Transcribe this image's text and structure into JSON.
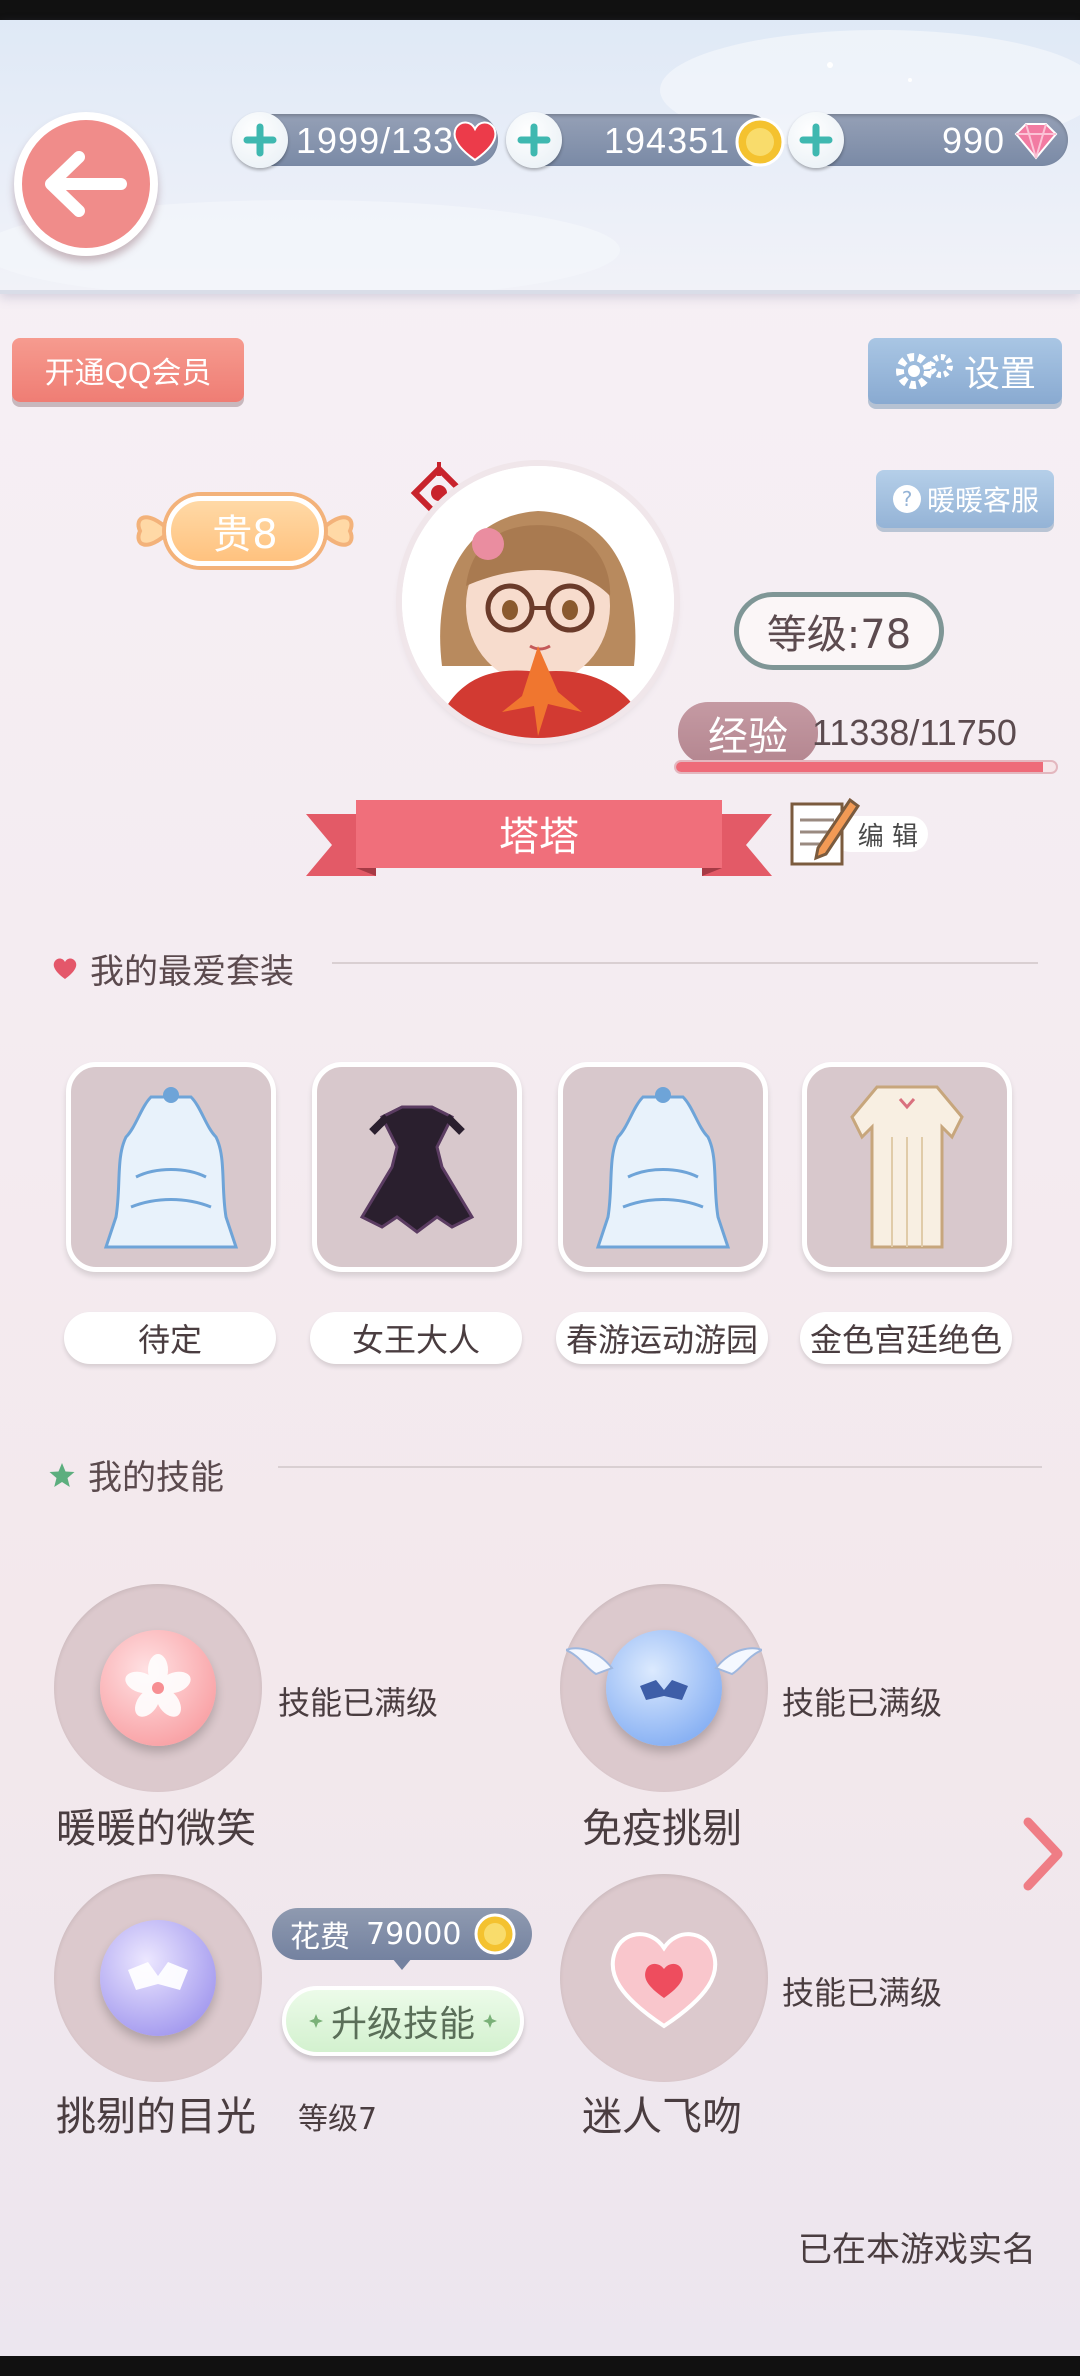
{
  "header": {
    "stamina": "1999/133",
    "gold": "194351",
    "diamonds": "990"
  },
  "buttons": {
    "vip": "开通QQ会员",
    "settings": "设置",
    "service": "暖暖客服",
    "edit": "编 辑"
  },
  "profile": {
    "noble_rank": "贵8",
    "level": "等级:78",
    "exp_label": "经验",
    "exp_value": "11338/11750",
    "exp_fraction": 0.965,
    "name": "塔塔"
  },
  "favorites": {
    "title": "我的最爱套装",
    "items": [
      {
        "label": "待定"
      },
      {
        "label": "女王大人"
      },
      {
        "label": "春游运动游园"
      },
      {
        "label": "金色宫廷绝色"
      }
    ]
  },
  "skills": {
    "title": "我的技能",
    "items": [
      {
        "name": "暖暖的微笑",
        "status": "技能已满级"
      },
      {
        "name": "免疫挑剔",
        "status": "技能已满级"
      },
      {
        "name": "挑剔的目光",
        "status": "等级7"
      },
      {
        "name": "迷人飞吻",
        "status": "技能已满级"
      }
    ],
    "cost_label": "花费",
    "cost_value": "79000",
    "upgrade_label": "升级技能"
  },
  "footer": {
    "realname": "已在本游戏实名"
  },
  "colors": {
    "accent_pink": "#ee6b79",
    "button_blue": "#89aad1",
    "ribbon": "#f06f7b"
  }
}
